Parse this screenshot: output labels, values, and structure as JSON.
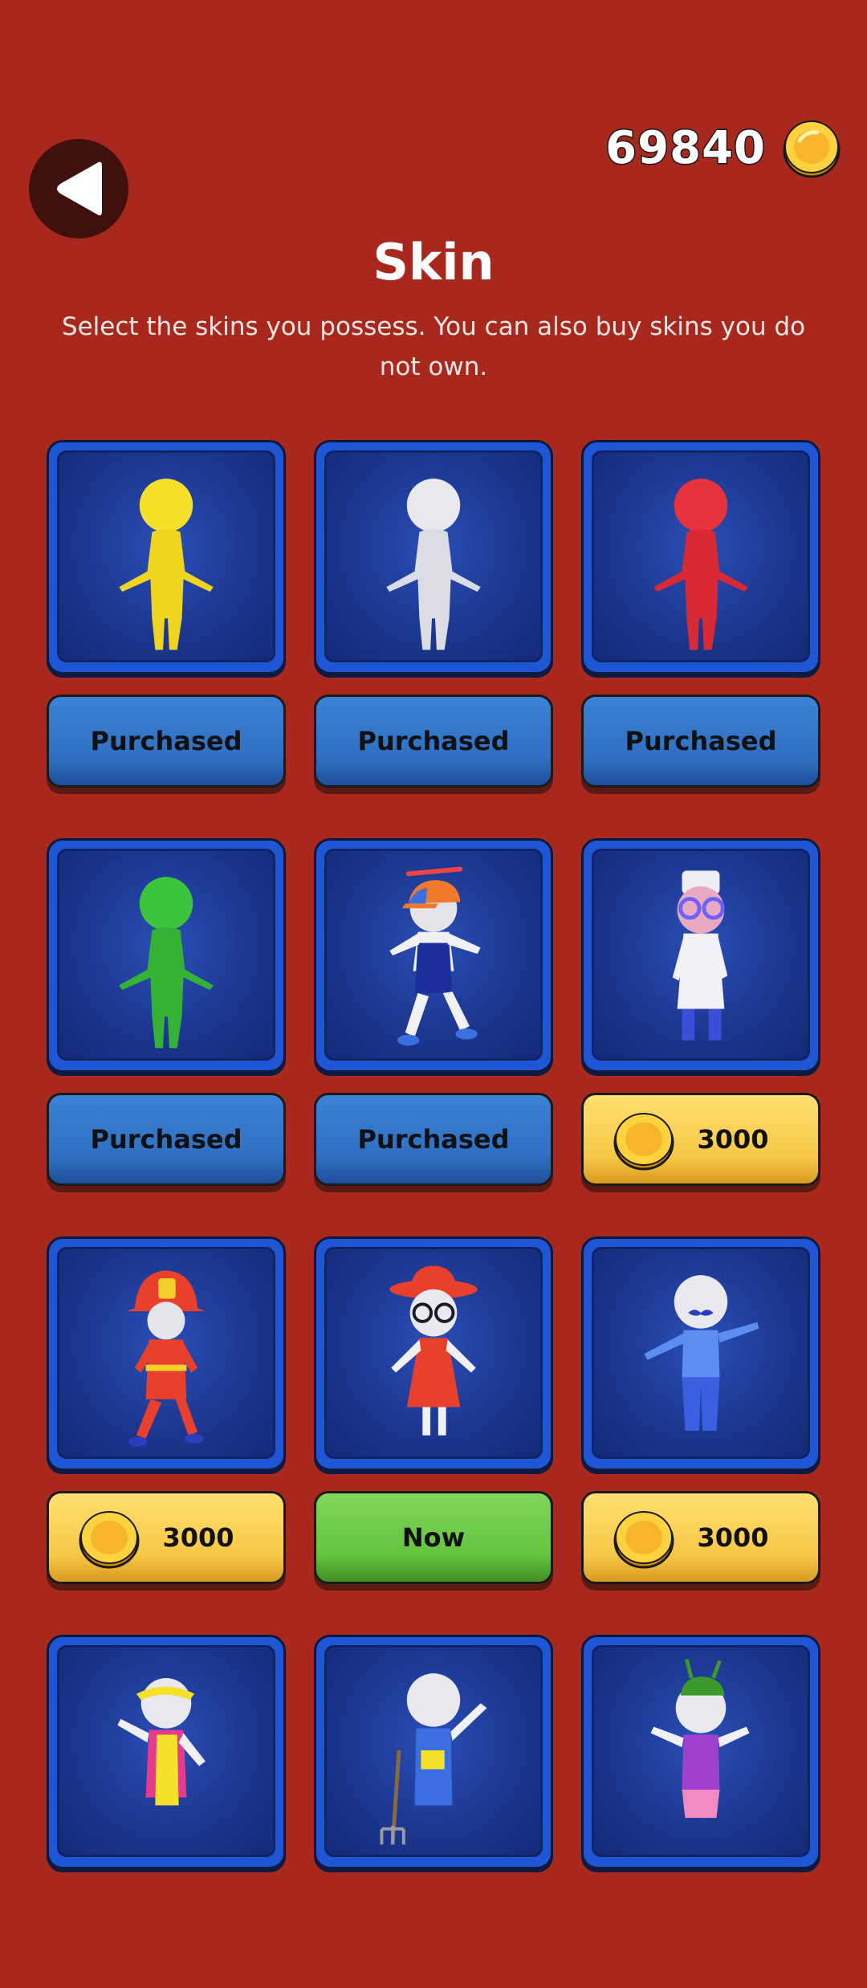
{
  "header": {
    "coin_count": "69840",
    "title": "Skin",
    "subtitle": "Select the skins you possess. You can also buy skins you do not own."
  },
  "icons": {
    "back": "back-triangle-icon",
    "coin": "gold-coin-icon"
  },
  "colors": {
    "background": "#a9281d",
    "card_border": "#1e56d6",
    "owned_button": "#2f6fc2",
    "current_button": "#65c33f",
    "buy_button": "#f7c846"
  },
  "skins": [
    {
      "name": "yellow-stickman",
      "status": "owned",
      "label": "Purchased"
    },
    {
      "name": "white-stickman",
      "status": "owned",
      "label": "Purchased"
    },
    {
      "name": "red-stickman",
      "status": "owned",
      "label": "Purchased"
    },
    {
      "name": "green-stickman",
      "status": "owned",
      "label": "Purchased"
    },
    {
      "name": "propeller-cap-kid",
      "status": "owned",
      "label": "Purchased"
    },
    {
      "name": "doctor",
      "status": "buy",
      "label": "3000"
    },
    {
      "name": "firefighter",
      "status": "buy",
      "label": "3000"
    },
    {
      "name": "red-dress-lady",
      "status": "current",
      "label": "Now"
    },
    {
      "name": "mustache-man",
      "status": "buy",
      "label": "3000"
    },
    {
      "name": "visor-cook",
      "status": "buy",
      "label": ""
    },
    {
      "name": "farmer-pitchfork",
      "status": "buy",
      "label": ""
    },
    {
      "name": "alien-hat",
      "status": "buy",
      "label": ""
    }
  ]
}
